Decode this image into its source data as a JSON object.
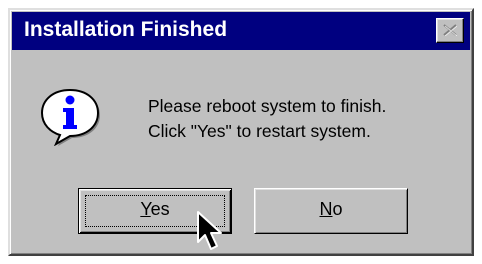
{
  "window": {
    "title": "Installation Finished"
  },
  "titlebar": {
    "close_icon": "close-icon"
  },
  "icon": {
    "name": "info-icon",
    "glyph": "i"
  },
  "message": {
    "line1": "Please reboot system to finish.",
    "line2": "Click \"Yes\" to restart system."
  },
  "buttons": {
    "yes": {
      "mnemonic": "Y",
      "rest": "es"
    },
    "no": {
      "mnemonic": "N",
      "rest": "o"
    }
  },
  "colors": {
    "titlebar": "#000080",
    "dialog_face": "#c0c0c0",
    "info_blue": "#0000ff"
  }
}
